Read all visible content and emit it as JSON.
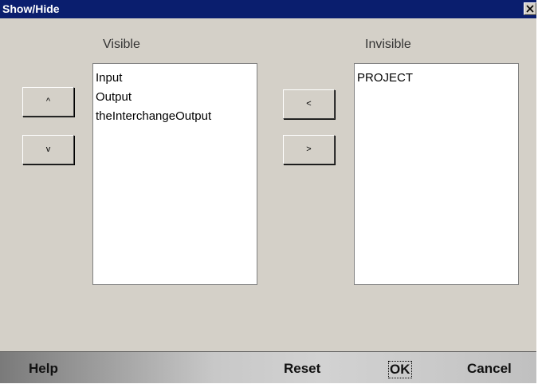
{
  "window": {
    "title": "Show/Hide"
  },
  "columns": {
    "visible_label": "Visible",
    "invisible_label": "Invisible"
  },
  "visible_list": [
    "Input",
    "Output",
    "theInterchangeOutput"
  ],
  "invisible_list": [
    "PROJECT"
  ],
  "buttons": {
    "move_up": "^",
    "move_down": "v",
    "move_left": "<",
    "move_right": ">"
  },
  "footer": {
    "help": "Help",
    "reset": "Reset",
    "ok": "OK",
    "cancel": "Cancel"
  },
  "icons": {
    "close": "close-icon"
  },
  "colors": {
    "titlebar": "#0a1e6e",
    "dialog_bg": "#d4d0c8",
    "list_bg": "#ffffff"
  }
}
